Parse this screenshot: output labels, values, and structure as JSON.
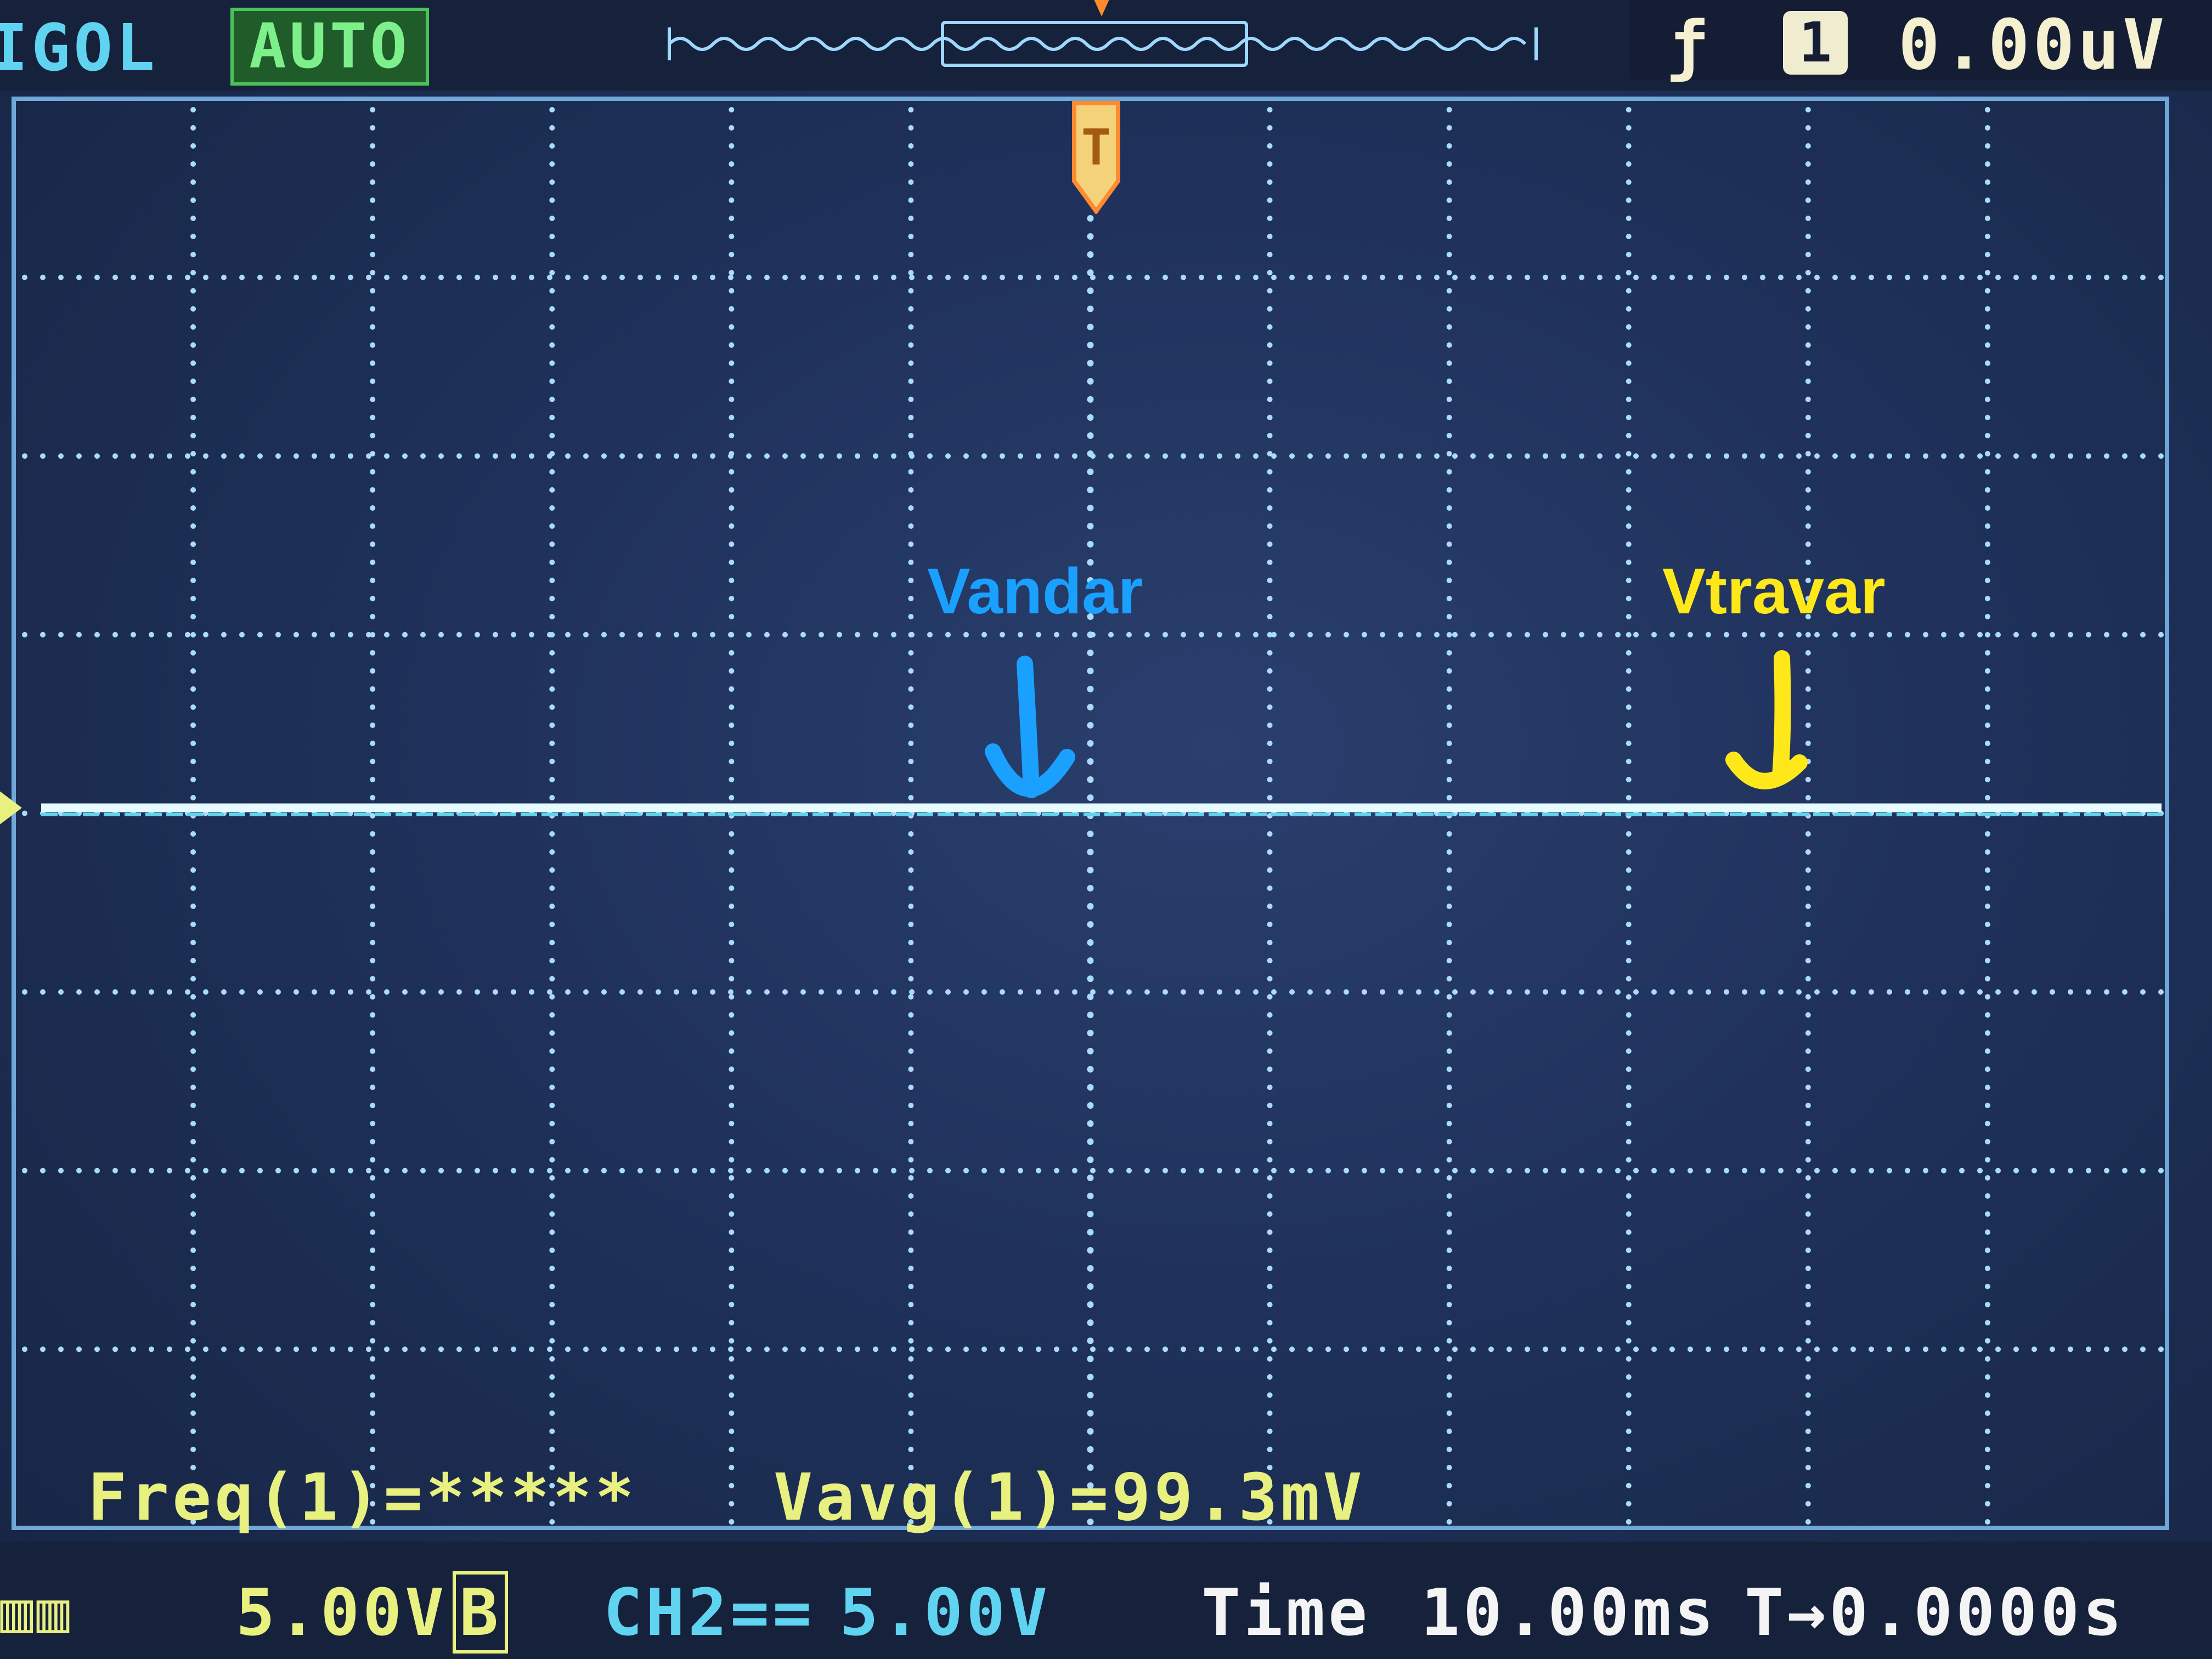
{
  "header": {
    "brand": "IGOL",
    "run_status": "AUTO",
    "trigger_level": "0.00uV",
    "trigger_source": "1",
    "trigger_edge_icon": "rising-edge-icon"
  },
  "screen": {
    "trigger_marker": "T",
    "colors": {
      "ch1": "#e8f080",
      "ch2": "#5fd3f0",
      "trace": "#e6fbff",
      "grid": "#a9dcf7",
      "annotation_ch2": "#1aa0ff",
      "annotation_ch1": "#ffe81a"
    }
  },
  "measurements": {
    "freq": "Freq(1)=*****",
    "vavg": "Vavg(1)=99.3mV"
  },
  "annotations": {
    "ch2_label": "Vandar",
    "ch1_label": "Vtravar"
  },
  "footer": {
    "ch1_icon": "ch1-coupling-icon",
    "ch1_scale": "5.00V",
    "ch1_bw": "B",
    "ch2_label": "CH2",
    "ch2_coupling": "==",
    "ch2_scale": "5.00V",
    "time_label": "Time",
    "time_scale": "10.00ms",
    "trigger_offset": "T→0.0000s"
  }
}
